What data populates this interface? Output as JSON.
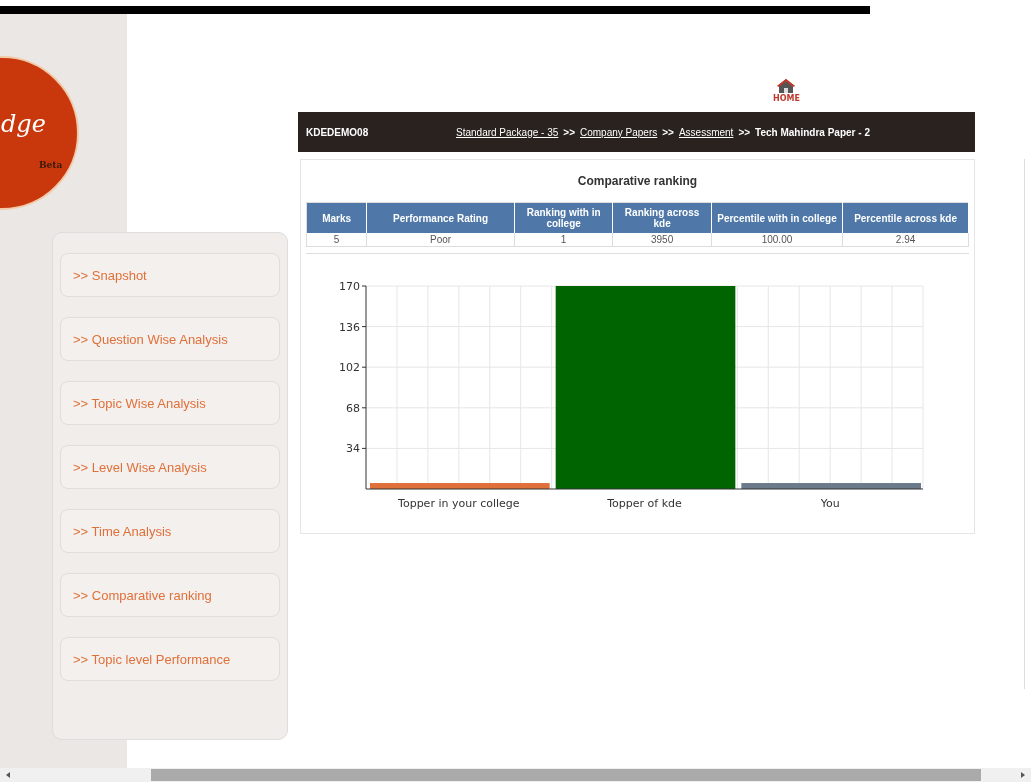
{
  "logo": {
    "text": "dge",
    "badge": "Beta"
  },
  "sidebar": {
    "items": [
      {
        "label": ">> Snapshot",
        "selected": false
      },
      {
        "label": ">> Question Wise Analysis",
        "selected": false
      },
      {
        "label": ">> Topic Wise Analysis",
        "selected": false
      },
      {
        "label": ">> Level Wise Analysis",
        "selected": false
      },
      {
        "label": ">> Time Analysis",
        "selected": false
      },
      {
        "label": ">> Comparative ranking",
        "selected": false
      },
      {
        "label": ">> Topic level Performance",
        "selected": false
      }
    ]
  },
  "home": {
    "label": "HOME"
  },
  "header": {
    "user": "KDEDEMO08",
    "breadcrumbs": [
      {
        "label": "Standard Package - 35",
        "link": true
      },
      {
        "label": "Company Papers",
        "link": true
      },
      {
        "label": "Assessment",
        "link": true
      },
      {
        "label": "Tech Mahindra Paper - 2",
        "link": false
      }
    ],
    "separator": ">>"
  },
  "panel": {
    "title": "Comparative ranking",
    "table": {
      "columns": [
        "Marks",
        "Performance Rating",
        "Ranking with in college",
        "Ranking across kde",
        "Percentile with in college",
        "Percentile across kde"
      ],
      "rows": [
        [
          "5",
          "Poor",
          "1",
          "3950",
          "100.00",
          "2.94"
        ]
      ]
    },
    "chart_data": {
      "type": "bar",
      "categories": [
        "Topper in your college",
        "Topper of kde",
        "You"
      ],
      "series": [
        {
          "color": "#e0703a",
          "values": [
            5,
            null,
            null
          ]
        },
        {
          "color": "#006400",
          "values": [
            null,
            170,
            null
          ]
        },
        {
          "color": "#6b7b8c",
          "values": [
            null,
            null,
            5
          ]
        }
      ],
      "stacked": true,
      "grid": true,
      "ylim": [
        0,
        170
      ],
      "yticks": [
        34,
        68,
        102,
        136,
        170
      ]
    }
  }
}
